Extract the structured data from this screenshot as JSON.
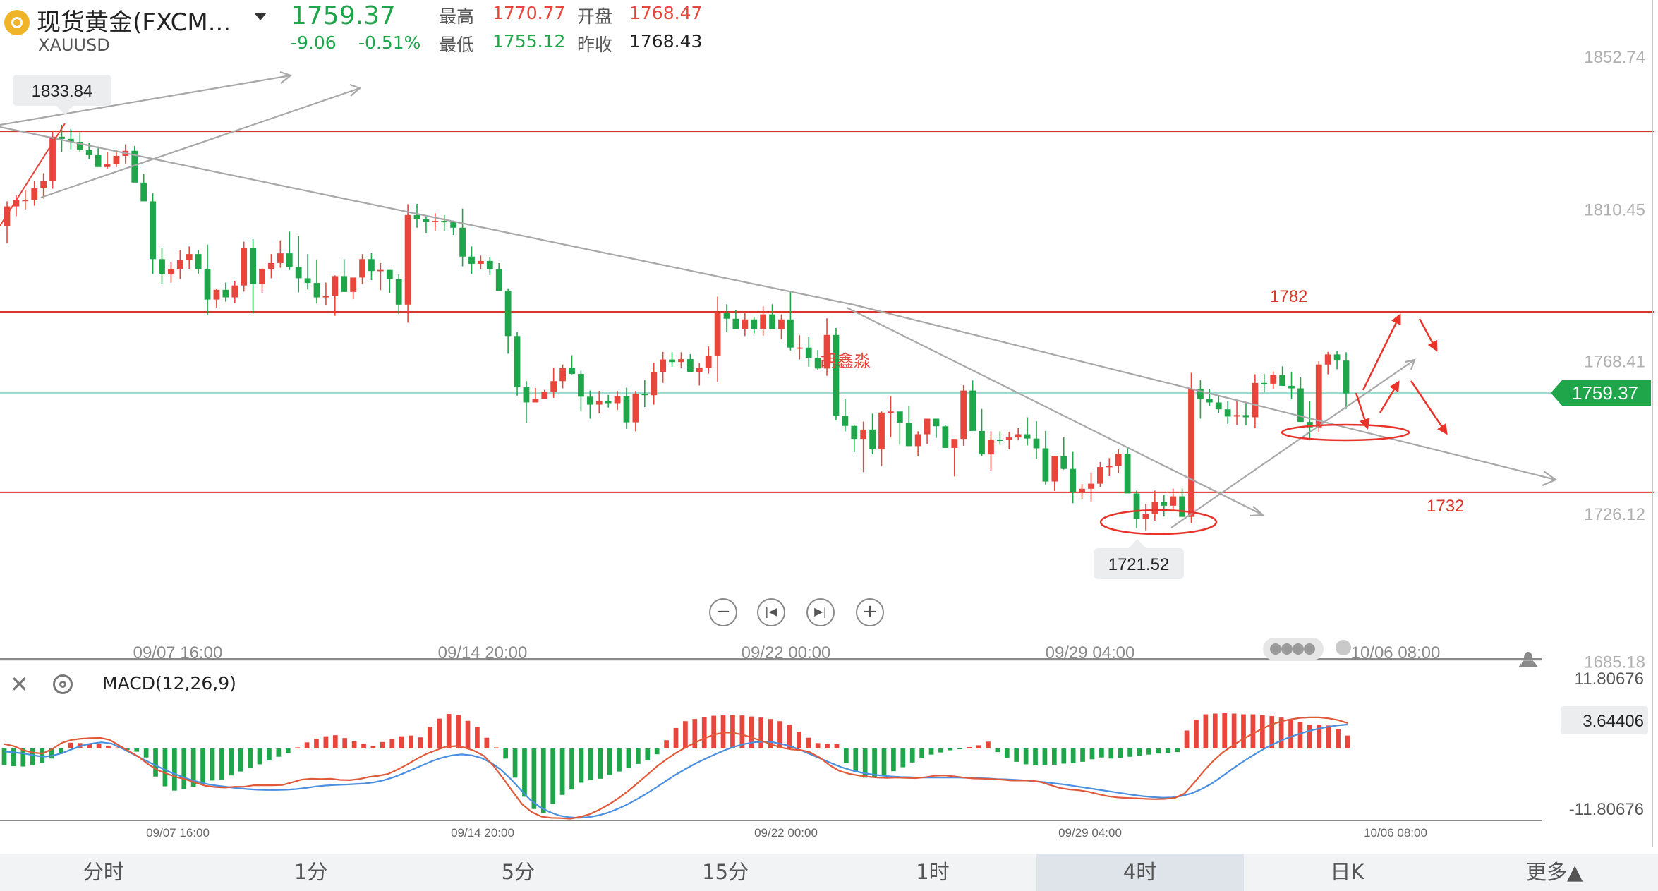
{
  "header": {
    "title": "现货黄金(FXCM...",
    "symbol": "XAUUSD",
    "price": "1759.37",
    "change": "-9.06",
    "change_pct": "-0.51%",
    "high_label": "最高",
    "high": "1770.77",
    "open_label": "开盘",
    "open": "1768.47",
    "low_label": "最低",
    "low": "1755.12",
    "prev_close_label": "昨收",
    "prev_close": "1768.43"
  },
  "colors": {
    "up": "#e8453c",
    "down": "#1fa64a",
    "level_line": "#d9362b",
    "trend_line": "#a8a8a8",
    "price_line": "#7ccfc0",
    "annotation": "#e8332b",
    "macd_dif": "#e05a3a",
    "macd_dea": "#4a8fe0"
  },
  "icons": [
    "gold-coin-icon",
    "caret-down-icon",
    "zoom-out-icon",
    "skip-back-icon",
    "skip-forward-icon",
    "zoom-in-icon",
    "close-icon",
    "settings-icon"
  ],
  "macd": {
    "label": "MACD(12,26,9)",
    "axis_top": "11.80676",
    "axis_bottom": "-11.80676",
    "current": "3.64406"
  },
  "chart_data": {
    "type": "candlestick",
    "timeframe": "4时",
    "price_axis": [
      "1852.74",
      "1810.45",
      "1768.41",
      "1726.12",
      "1685.18"
    ],
    "ylim": [
      1685.18,
      1852.74
    ],
    "x_axis_labels": [
      "09/07 16:00",
      "09/14 20:00",
      "09/22 00:00",
      "09/29 04:00",
      "10/06 08:00"
    ],
    "current_price": "1759.37",
    "marked_high": "1833.84",
    "marked_low": "1721.52",
    "annotations": [
      "1782",
      "1732",
      "胡鑫淼"
    ],
    "levels": [
      1832.0,
      1782.0,
      1732.0
    ],
    "candles_ohlc": [
      [
        1805.8,
        1812.6,
        1801.0,
        1811.2
      ],
      [
        1811.2,
        1814.3,
        1808.5,
        1812.9
      ],
      [
        1812.9,
        1815.7,
        1810.4,
        1813.0
      ],
      [
        1813.0,
        1818.2,
        1811.4,
        1816.2
      ],
      [
        1816.2,
        1820.4,
        1813.4,
        1818.3
      ],
      [
        1818.3,
        1832.0,
        1816.1,
        1830.5
      ],
      [
        1830.5,
        1833.8,
        1826.3,
        1829.9
      ],
      [
        1829.9,
        1832.7,
        1827.0,
        1829.1
      ],
      [
        1829.1,
        1831.7,
        1826.2,
        1826.8
      ],
      [
        1826.8,
        1828.9,
        1824.3,
        1825.4
      ],
      [
        1825.4,
        1827.8,
        1822.3,
        1822.1
      ],
      [
        1822.1,
        1826.2,
        1821.7,
        1823.0
      ],
      [
        1823.0,
        1826.9,
        1822.1,
        1825.2
      ],
      [
        1825.2,
        1828.4,
        1823.1,
        1826.6
      ],
      [
        1826.6,
        1827.9,
        1819.9,
        1817.8
      ],
      [
        1817.8,
        1820.2,
        1812.7,
        1812.6
      ],
      [
        1812.6,
        1814.8,
        1792.5,
        1796.6
      ],
      [
        1796.6,
        1799.8,
        1789.8,
        1792.4
      ],
      [
        1792.4,
        1795.8,
        1790.1,
        1793.9
      ],
      [
        1793.9,
        1799.2,
        1791.1,
        1796.4
      ],
      [
        1796.4,
        1800.1,
        1793.9,
        1798.0
      ],
      [
        1798.0,
        1799.1,
        1792.6,
        1793.9
      ],
      [
        1793.9,
        1800.6,
        1781.1,
        1785.4
      ],
      [
        1785.4,
        1788.4,
        1783.2,
        1788.1
      ],
      [
        1788.1,
        1790.1,
        1784.8,
        1786.0
      ],
      [
        1786.0,
        1790.6,
        1784.4,
        1789.3
      ],
      [
        1789.3,
        1801.4,
        1787.6,
        1799.6
      ],
      [
        1799.6,
        1802.1,
        1781.5,
        1789.7
      ],
      [
        1789.7,
        1794.0,
        1787.3,
        1793.9
      ],
      [
        1793.9,
        1798.0,
        1791.3,
        1795.5
      ],
      [
        1795.5,
        1801.8,
        1794.2,
        1798.2
      ],
      [
        1798.2,
        1804.2,
        1793.6,
        1794.4
      ],
      [
        1794.4,
        1803.1,
        1787.4,
        1791.3
      ],
      [
        1791.3,
        1798.0,
        1788.2,
        1790.0
      ],
      [
        1790.0,
        1796.5,
        1784.3,
        1786.0
      ],
      [
        1786.0,
        1790.1,
        1783.9,
        1786.4
      ],
      [
        1786.4,
        1792.1,
        1780.9,
        1791.9
      ],
      [
        1791.9,
        1796.6,
        1790.4,
        1787.5
      ],
      [
        1787.5,
        1791.2,
        1785.5,
        1791.5
      ],
      [
        1791.5,
        1798.0,
        1789.7,
        1796.6
      ],
      [
        1796.6,
        1798.3,
        1790.8,
        1793.3
      ],
      [
        1793.3,
        1795.5,
        1788.0,
        1793.6
      ],
      [
        1793.6,
        1793.6,
        1787.2,
        1791.1
      ],
      [
        1791.1,
        1792.4,
        1781.4,
        1784.0
      ],
      [
        1784.0,
        1811.8,
        1779.0,
        1808.8
      ],
      [
        1808.8,
        1811.9,
        1805.3,
        1807.6
      ],
      [
        1807.6,
        1808.4,
        1803.9,
        1806.9
      ],
      [
        1806.9,
        1809.3,
        1804.5,
        1807.2
      ],
      [
        1807.2,
        1808.8,
        1804.4,
        1806.8
      ],
      [
        1806.8,
        1807.3,
        1803.3,
        1805.3
      ],
      [
        1805.3,
        1810.6,
        1794.6,
        1797.3
      ],
      [
        1797.3,
        1800.1,
        1792.5,
        1795.3
      ],
      [
        1795.3,
        1797.6,
        1793.9,
        1796.1
      ],
      [
        1796.1,
        1797.1,
        1792.2,
        1793.8
      ],
      [
        1793.8,
        1795.5,
        1788.5,
        1787.8
      ],
      [
        1787.8,
        1788.5,
        1770.4,
        1775.3
      ],
      [
        1775.3,
        1776.4,
        1758.8,
        1761.1
      ],
      [
        1761.1,
        1762.8,
        1751.3,
        1756.9
      ],
      [
        1756.9,
        1760.9,
        1757.3,
        1757.9
      ],
      [
        1757.9,
        1760.4,
        1758.6,
        1759.9
      ],
      [
        1759.9,
        1766.5,
        1758.2,
        1762.8
      ],
      [
        1762.8,
        1767.4,
        1760.8,
        1766.4
      ],
      [
        1766.4,
        1770.0,
        1764.7,
        1764.8
      ],
      [
        1764.8,
        1765.7,
        1754.4,
        1758.5
      ],
      [
        1758.5,
        1760.2,
        1752.4,
        1756.3
      ],
      [
        1756.3,
        1760.1,
        1753.9,
        1757.4
      ],
      [
        1757.4,
        1759.0,
        1755.5,
        1756.7
      ],
      [
        1756.7,
        1760.1,
        1754.8,
        1758.6
      ],
      [
        1758.6,
        1761.0,
        1749.6,
        1751.4
      ],
      [
        1751.4,
        1760.1,
        1748.9,
        1759.3
      ],
      [
        1759.3,
        1763.1,
        1755.6,
        1758.9
      ],
      [
        1758.9,
        1767.9,
        1756.3,
        1765.3
      ],
      [
        1765.3,
        1770.9,
        1762.3,
        1768.8
      ],
      [
        1768.8,
        1770.8,
        1766.8,
        1768.1
      ],
      [
        1768.1,
        1770.8,
        1766.4,
        1768.9
      ],
      [
        1768.9,
        1770.3,
        1766.0,
        1765.4
      ],
      [
        1765.4,
        1767.8,
        1761.6,
        1766.5
      ],
      [
        1766.5,
        1772.4,
        1764.9,
        1769.9
      ],
      [
        1769.9,
        1786.2,
        1762.6,
        1781.7
      ],
      [
        1781.7,
        1784.1,
        1776.4,
        1780.1
      ],
      [
        1780.1,
        1782.4,
        1778.1,
        1777.2
      ],
      [
        1777.2,
        1781.6,
        1775.3,
        1779.9
      ],
      [
        1779.9,
        1780.6,
        1776.0,
        1777.3
      ],
      [
        1777.3,
        1783.5,
        1775.4,
        1781.3
      ],
      [
        1781.3,
        1784.1,
        1778.3,
        1777.2
      ],
      [
        1777.2,
        1781.3,
        1774.4,
        1779.9
      ],
      [
        1779.9,
        1787.5,
        1771.3,
        1772.1
      ],
      [
        1772.1,
        1775.5,
        1768.8,
        1772.1
      ],
      [
        1772.1,
        1775.1,
        1766.8,
        1769.3
      ],
      [
        1769.3,
        1771.4,
        1765.8,
        1766.3
      ],
      [
        1766.3,
        1780.2,
        1764.3,
        1775.6
      ],
      [
        1775.6,
        1777.5,
        1751.9,
        1753.2
      ],
      [
        1753.2,
        1757.9,
        1748.9,
        1750.4
      ],
      [
        1750.4,
        1750.7,
        1743.1,
        1746.8
      ],
      [
        1746.8,
        1751.6,
        1737.6,
        1749.4
      ],
      [
        1749.4,
        1753.8,
        1742.5,
        1743.9
      ],
      [
        1743.9,
        1754.4,
        1739.2,
        1754.1
      ],
      [
        1754.1,
        1758.6,
        1747.2,
        1754.4
      ],
      [
        1754.4,
        1754.0,
        1745.2,
        1751.3
      ],
      [
        1751.3,
        1755.9,
        1749.1,
        1744.8
      ],
      [
        1744.8,
        1748.9,
        1742.0,
        1748.1
      ],
      [
        1748.1,
        1752.0,
        1745.4,
        1752.4
      ],
      [
        1752.4,
        1751.2,
        1747.1,
        1750.3
      ],
      [
        1750.3,
        1750.7,
        1748.5,
        1744.3
      ],
      [
        1744.3,
        1744.5,
        1736.4,
        1746.8
      ],
      [
        1746.8,
        1761.7,
        1744.9,
        1760.2
      ],
      [
        1760.2,
        1763.0,
        1751.8,
        1749.0
      ],
      [
        1749.0,
        1755.1,
        1742.0,
        1742.5
      ],
      [
        1742.5,
        1748.9,
        1738.0,
        1746.6
      ],
      [
        1746.6,
        1748.9,
        1745.2,
        1746.5
      ],
      [
        1746.5,
        1748.8,
        1743.9,
        1747.2
      ],
      [
        1747.2,
        1749.8,
        1746.4,
        1748.1
      ],
      [
        1748.1,
        1752.8,
        1745.0,
        1746.9
      ],
      [
        1746.9,
        1751.7,
        1741.3,
        1744.2
      ],
      [
        1744.2,
        1749.0,
        1734.2,
        1735.0
      ],
      [
        1735.0,
        1741.5,
        1732.4,
        1742.1
      ],
      [
        1742.1,
        1747.2,
        1738.3,
        1738.5
      ],
      [
        1738.5,
        1743.2,
        1729.0,
        1732.1
      ],
      [
        1732.1,
        1734.3,
        1730.2,
        1733.0
      ],
      [
        1733.0,
        1737.5,
        1729.5,
        1734.4
      ],
      [
        1734.4,
        1740.4,
        1733.5,
        1739.0
      ],
      [
        1739.0,
        1741.5,
        1736.5,
        1739.3
      ],
      [
        1739.3,
        1743.9,
        1737.4,
        1742.7
      ],
      [
        1742.7,
        1744.2,
        1735.7,
        1731.7
      ],
      [
        1731.7,
        1732.5,
        1722.1,
        1724.6
      ],
      [
        1724.6,
        1728.8,
        1721.5,
        1726.0
      ],
      [
        1726.0,
        1732.5,
        1724.1,
        1729.3
      ],
      [
        1729.3,
        1731.2,
        1725.3,
        1728.3
      ],
      [
        1728.3,
        1733.0,
        1726.8,
        1730.9
      ],
      [
        1730.9,
        1733.1,
        1728.2,
        1725.2
      ],
      [
        1725.2,
        1765.1,
        1723.5,
        1760.7
      ],
      [
        1760.7,
        1763.1,
        1752.4,
        1757.8
      ],
      [
        1757.8,
        1760.6,
        1755.9,
        1756.9
      ],
      [
        1756.9,
        1758.8,
        1754.0,
        1755.0
      ],
      [
        1755.0,
        1757.3,
        1751.0,
        1753.0
      ],
      [
        1753.0,
        1757.4,
        1750.7,
        1753.4
      ],
      [
        1753.4,
        1756.7,
        1750.6,
        1752.8
      ],
      [
        1752.8,
        1764.7,
        1749.8,
        1762.3
      ],
      [
        1762.3,
        1764.8,
        1759.7,
        1762.1
      ],
      [
        1762.1,
        1765.5,
        1760.6,
        1764.5
      ],
      [
        1764.5,
        1766.9,
        1762.1,
        1761.5
      ],
      [
        1761.5,
        1765.4,
        1757.8,
        1760.8
      ],
      [
        1760.8,
        1763.9,
        1756.9,
        1751.5
      ],
      [
        1751.5,
        1757.3,
        1746.4,
        1750.0
      ],
      [
        1750.0,
        1768.3,
        1748.6,
        1767.4
      ],
      [
        1767.4,
        1770.9,
        1764.7,
        1770.2
      ],
      [
        1770.2,
        1771.2,
        1766.1,
        1768.5
      ],
      [
        1768.5,
        1770.8,
        1755.1,
        1759.4
      ]
    ],
    "macd_hist": [
      -4.6,
      -4.9,
      -5.0,
      -4.7,
      -4.0,
      -2.8,
      -1.5,
      1.6,
      1.5,
      1.4,
      1.2,
      0.8,
      0.3,
      -0.4,
      -0.9,
      -2.5,
      -7.8,
      -10.5,
      -11.7,
      -11.3,
      -10.6,
      -9.9,
      -8.9,
      -8.7,
      -7.5,
      -6.4,
      -5.4,
      -4.4,
      -3.3,
      -2.3,
      -1.3,
      0.3,
      1.7,
      2.7,
      3.4,
      3.7,
      2.9,
      2.0,
      1.3,
      0.7,
      1.8,
      2.6,
      3.4,
      3.6,
      3.1,
      6.0,
      8.3,
      9.6,
      9.3,
      7.7,
      6.0,
      3.0,
      0.3,
      -2.8,
      -8.1,
      -13.4,
      -16.8,
      -17.9,
      -15.4,
      -12.9,
      -11.4,
      -9.5,
      -8.8,
      -8.4,
      -7.4,
      -6.4,
      -5.4,
      -4.3,
      -3.3,
      -1.6,
      2.3,
      5.7,
      7.6,
      8.2,
      8.8,
      9.1,
      9.2,
      9.3,
      9.2,
      8.9,
      8.6,
      8.2,
      7.6,
      6.6,
      4.7,
      3.0,
      1.5,
      1.3,
      1.2,
      -4.1,
      -6.6,
      -8.1,
      -8.0,
      -7.6,
      -6.3,
      -5.2,
      -3.9,
      -2.7,
      -1.7,
      -1.1,
      -0.5,
      -0.2,
      0.4,
      0.9,
      1.9,
      -1.0,
      -2.6,
      -3.7,
      -4.4,
      -4.7,
      -4.6,
      -4.5,
      -4.2,
      -4.1,
      -3.7,
      -3.0,
      -2.5,
      -2.8,
      -2.6,
      -2.3,
      -2.0,
      -1.7,
      -1.4,
      -1.2,
      -1.0,
      5.0,
      8.0,
      9.5,
      9.7,
      9.8,
      9.7,
      9.5,
      9.5,
      9.3,
      9.0,
      8.6,
      8.0,
      7.3,
      6.6,
      6.6,
      6.4,
      5.4,
      3.6
    ],
    "macd_dif": [
      1.5,
      0.8,
      -0.6,
      -1.4,
      -1.7,
      -0.2,
      1.9,
      2.9,
      3.3,
      3.5,
      3.6,
      2.9,
      1.0,
      -0.9,
      -2.8,
      -5.3,
      -7.3,
      -8.6,
      -9.7,
      -10.5,
      -11.6,
      -12.6,
      -13.0,
      -13.2,
      -12.9,
      -12.9,
      -12.4,
      -12.4,
      -12.4,
      -12.3,
      -11.4,
      -10.5,
      -10.2,
      -10.3,
      -10.2,
      -10.6,
      -10.7,
      -10.3,
      -9.6,
      -9.2,
      -8.6,
      -7.1,
      -5.4,
      -3.5,
      -1.8,
      -0.6,
      0.6,
      0.8,
      0.3,
      -0.8,
      -2.5,
      -5.9,
      -10.1,
      -14.6,
      -18.9,
      -21.5,
      -23.0,
      -23.4,
      -23.5,
      -23.7,
      -23.1,
      -22.2,
      -20.7,
      -18.9,
      -16.8,
      -14.4,
      -11.7,
      -8.9,
      -6.1,
      -3.7,
      -1.5,
      0.3,
      2.0,
      3.5,
      4.7,
      5.4,
      5.3,
      4.6,
      3.6,
      2.5,
      1.3,
      0.3,
      -0.3,
      -0.5,
      -1.3,
      -3.1,
      -5.6,
      -7.5,
      -8.5,
      -9.1,
      -9.5,
      -9.8,
      -9.9,
      -9.8,
      -9.9,
      -10.0,
      -9.7,
      -9.2,
      -9.1,
      -9.4,
      -9.8,
      -10.1,
      -10.2,
      -10.3,
      -10.5,
      -10.8,
      -10.8,
      -10.8,
      -11.3,
      -12.3,
      -13.3,
      -13.8,
      -14.1,
      -14.6,
      -15.4,
      -16.1,
      -16.5,
      -16.7,
      -16.8,
      -17.0,
      -17.1,
      -17.0,
      -16.7,
      -15.2,
      -11.6,
      -7.7,
      -4.2,
      -1.3,
      0.9,
      3.0,
      4.8,
      6.5,
      8.0,
      9.1,
      9.8,
      10.3,
      10.5,
      10.5,
      10.2,
      9.6,
      8.6
    ],
    "macd_dea": [
      -1.0,
      -1.3,
      -1.7,
      -2.3,
      -2.8,
      -2.4,
      -1.5,
      -0.2,
      1.0,
      1.7,
      2.1,
      1.7,
      0.2,
      -1.5,
      -3.2,
      -4.8,
      -6.4,
      -7.9,
      -9.2,
      -10.4,
      -11.3,
      -12.1,
      -12.6,
      -13.0,
      -13.4,
      -13.7,
      -13.9,
      -14.0,
      -14.0,
      -13.9,
      -13.7,
      -13.3,
      -12.8,
      -12.5,
      -12.3,
      -12.2,
      -12.0,
      -11.8,
      -11.4,
      -10.7,
      -9.7,
      -8.4,
      -7.0,
      -5.6,
      -4.2,
      -3.1,
      -2.3,
      -2.0,
      -2.3,
      -3.2,
      -4.8,
      -7.1,
      -10.2,
      -13.7,
      -17.2,
      -19.7,
      -21.4,
      -22.6,
      -23.2,
      -23.4,
      -23.2,
      -22.6,
      -21.7,
      -20.4,
      -18.9,
      -17.1,
      -15.2,
      -13.1,
      -10.9,
      -8.8,
      -6.9,
      -5.1,
      -3.5,
      -2.0,
      -0.6,
      0.6,
      1.5,
      2.1,
      2.3,
      2.1,
      1.4,
      0.5,
      -0.8,
      -2.2,
      -3.6,
      -5.0,
      -6.3,
      -7.3,
      -8.1,
      -8.7,
      -9.1,
      -9.4,
      -9.6,
      -9.7,
      -9.8,
      -9.8,
      -9.8,
      -9.8,
      -9.8,
      -9.9,
      -10.0,
      -10.1,
      -10.3,
      -10.4,
      -10.6,
      -10.8,
      -11.1,
      -11.4,
      -11.8,
      -12.2,
      -12.7,
      -13.2,
      -13.7,
      -14.2,
      -14.7,
      -15.2,
      -15.7,
      -16.1,
      -16.4,
      -16.6,
      -16.5,
      -16.0,
      -15.1,
      -13.7,
      -11.9,
      -9.7,
      -7.3,
      -5.0,
      -2.9,
      -0.9,
      0.9,
      2.4,
      3.8,
      4.9,
      5.9,
      6.7,
      7.3,
      7.8,
      8.1
    ],
    "macd_ylim": [
      -11.80676,
      11.80676
    ]
  },
  "tabs": [
    {
      "label": "分时",
      "active": false
    },
    {
      "label": "1分",
      "active": false
    },
    {
      "label": "5分",
      "active": false
    },
    {
      "label": "15分",
      "active": false
    },
    {
      "label": "1时",
      "active": false
    },
    {
      "label": "4时",
      "active": true
    },
    {
      "label": "日K",
      "active": false
    },
    {
      "label": "更多▲",
      "active": false
    }
  ]
}
